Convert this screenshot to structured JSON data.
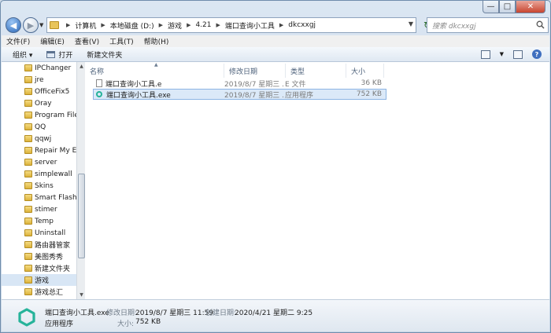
{
  "window": {
    "controls": {
      "minimize": "—",
      "maximize": "□",
      "close": "✕"
    }
  },
  "navigation": {
    "back": "◀",
    "forward": "▶",
    "history_dropdown": "▼",
    "breadcrumbs": [
      "计算机",
      "本地磁盘 (D:)",
      "游戏",
      "4.21",
      "端口查询小工具",
      "dkcxxgj"
    ],
    "refresh": "↻",
    "search_placeholder": "搜索 dkcxxgj"
  },
  "menu": [
    "文件(F)",
    "编辑(E)",
    "查看(V)",
    "工具(T)",
    "帮助(H)"
  ],
  "toolbar": {
    "organize": "组织 ▾",
    "open": "打开",
    "new_folder": "新建文件夹"
  },
  "sidebar": {
    "items": [
      "IPChanger",
      "jre",
      "OfficeFix5",
      "Oray",
      "Program Files",
      "QQ",
      "qqwj",
      "Repair My Exe",
      "server",
      "simplewall",
      "Skins",
      "Smart Flash R",
      "stimer",
      "Temp",
      "Uninstall",
      "路由器管家",
      "美图秀秀",
      "新建文件夹",
      "游戏",
      "游戏总汇"
    ],
    "selected_index": 18
  },
  "columns": {
    "name": "名称",
    "modified": "修改日期",
    "type": "类型",
    "size": "大小"
  },
  "files": [
    {
      "name": "端口查询小工具.e",
      "modified": "2019/8/7 星期三 ...",
      "type": "E 文件",
      "size": "36 KB",
      "icon": "document-icon"
    },
    {
      "name": "端口查询小工具.exe",
      "modified": "2019/8/7 星期三 ...",
      "type": "应用程序",
      "size": "752 KB",
      "icon": "app-icon"
    }
  ],
  "details": {
    "name": "端口查询小工具.exe",
    "modified_label": "修改日期:",
    "modified_value": "2019/8/7 星期三 11:59",
    "created_label": "创建日期:",
    "created_value": "2020/4/21 星期二 9:25",
    "type": "应用程序",
    "size_label": "大小:",
    "size_value": "752 KB"
  },
  "colors": {
    "accent": "#26b39a",
    "selection": "#dbe9f8"
  }
}
